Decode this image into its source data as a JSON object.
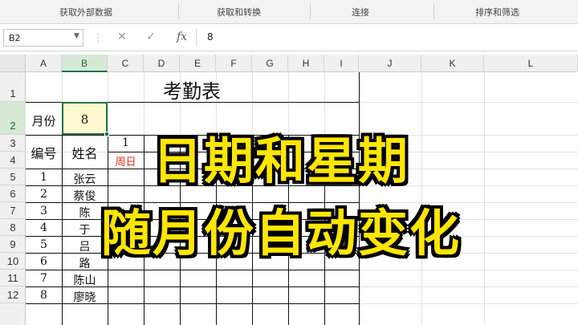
{
  "ribbon": {
    "groups": [
      "获取外部数据",
      "获取和转换",
      "连接",
      "排序和筛选"
    ]
  },
  "formula_bar": {
    "name_box": "B2",
    "value": "8",
    "cancel_icon": "close-icon",
    "confirm_icon": "check-icon",
    "function_label": "fx"
  },
  "columns": [
    "A",
    "B",
    "C",
    "D",
    "E",
    "F",
    "G",
    "H",
    "I",
    "J",
    "K",
    "L"
  ],
  "rows": [
    "1",
    "2",
    "3",
    "4",
    "5",
    "6",
    "7",
    "8",
    "9",
    "10",
    "11",
    "12"
  ],
  "sheet": {
    "title": "考勤表",
    "month_label": "月份",
    "month_value": "8",
    "id_header": "编号",
    "name_header": "姓名",
    "day_number": "1",
    "weekday": "周日",
    "weekday_color": "#e0301e",
    "people": [
      {
        "id": "1",
        "name": "张云"
      },
      {
        "id": "2",
        "name": "蔡俊"
      },
      {
        "id": "3",
        "name": "陈"
      },
      {
        "id": "4",
        "name": "于"
      },
      {
        "id": "5",
        "name": "吕"
      },
      {
        "id": "6",
        "name": "路"
      },
      {
        "id": "7",
        "name": "陈山"
      },
      {
        "id": "8",
        "name": "廖晓"
      }
    ]
  },
  "overlay": {
    "line1": "日期和星期",
    "line2": "随月份自动变化",
    "color": "#ffe600"
  },
  "accent": "#217346"
}
